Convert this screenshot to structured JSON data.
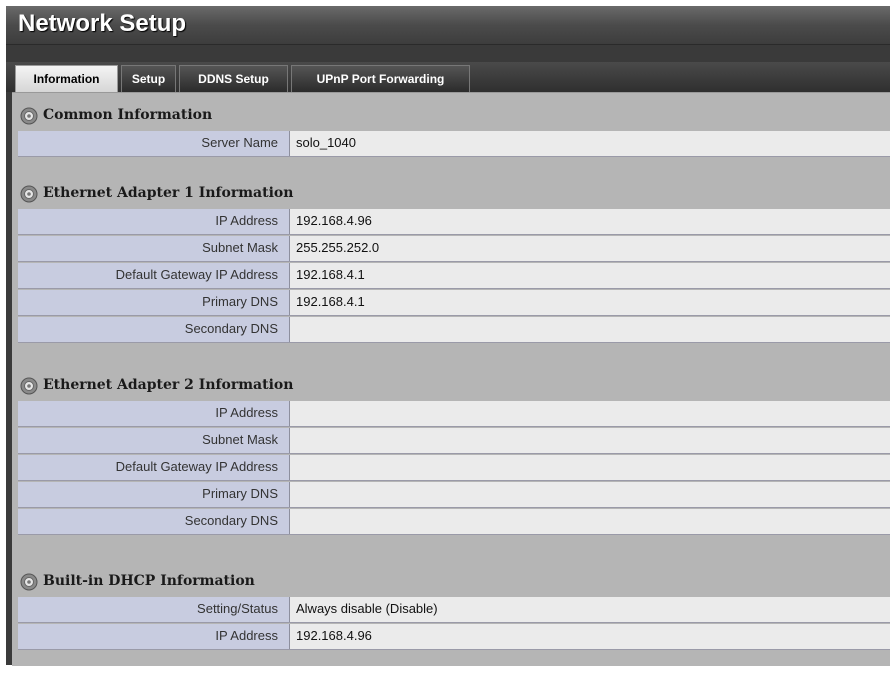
{
  "title": "Network Setup",
  "tabs": [
    {
      "label": "Information",
      "active": true
    },
    {
      "label": "Setup",
      "active": false
    },
    {
      "label": "DDNS Setup",
      "active": false
    },
    {
      "label": "UPnP Port Forwarding",
      "active": false
    }
  ],
  "sections": {
    "common": {
      "title": "Common Information",
      "rows": [
        {
          "label": "Server Name",
          "value": "solo_1040"
        }
      ]
    },
    "eth1": {
      "title": "Ethernet Adapter 1 Information",
      "rows": [
        {
          "label": "IP Address",
          "value": "192.168.4.96"
        },
        {
          "label": "Subnet Mask",
          "value": "255.255.252.0"
        },
        {
          "label": "Default Gateway IP Address",
          "value": "192.168.4.1"
        },
        {
          "label": "Primary DNS",
          "value": "192.168.4.1"
        },
        {
          "label": "Secondary DNS",
          "value": ""
        }
      ]
    },
    "eth2": {
      "title": "Ethernet Adapter 2 Information",
      "rows": [
        {
          "label": "IP Address",
          "value": ""
        },
        {
          "label": "Subnet Mask",
          "value": ""
        },
        {
          "label": "Default Gateway IP Address",
          "value": ""
        },
        {
          "label": "Primary DNS",
          "value": ""
        },
        {
          "label": "Secondary DNS",
          "value": ""
        }
      ]
    },
    "dhcp": {
      "title": "Built-in DHCP Information",
      "rows": [
        {
          "label": "Setting/Status",
          "value": "Always disable (Disable)"
        },
        {
          "label": "IP Address",
          "value": "192.168.4.96"
        }
      ]
    }
  },
  "icons": {
    "section": "gear-icon"
  },
  "colors": {
    "label_bg": "#c8cce0",
    "value_bg": "#ebebeb",
    "panel_bg": "#b5b5b5",
    "title_bg": "#4b4b4b"
  }
}
